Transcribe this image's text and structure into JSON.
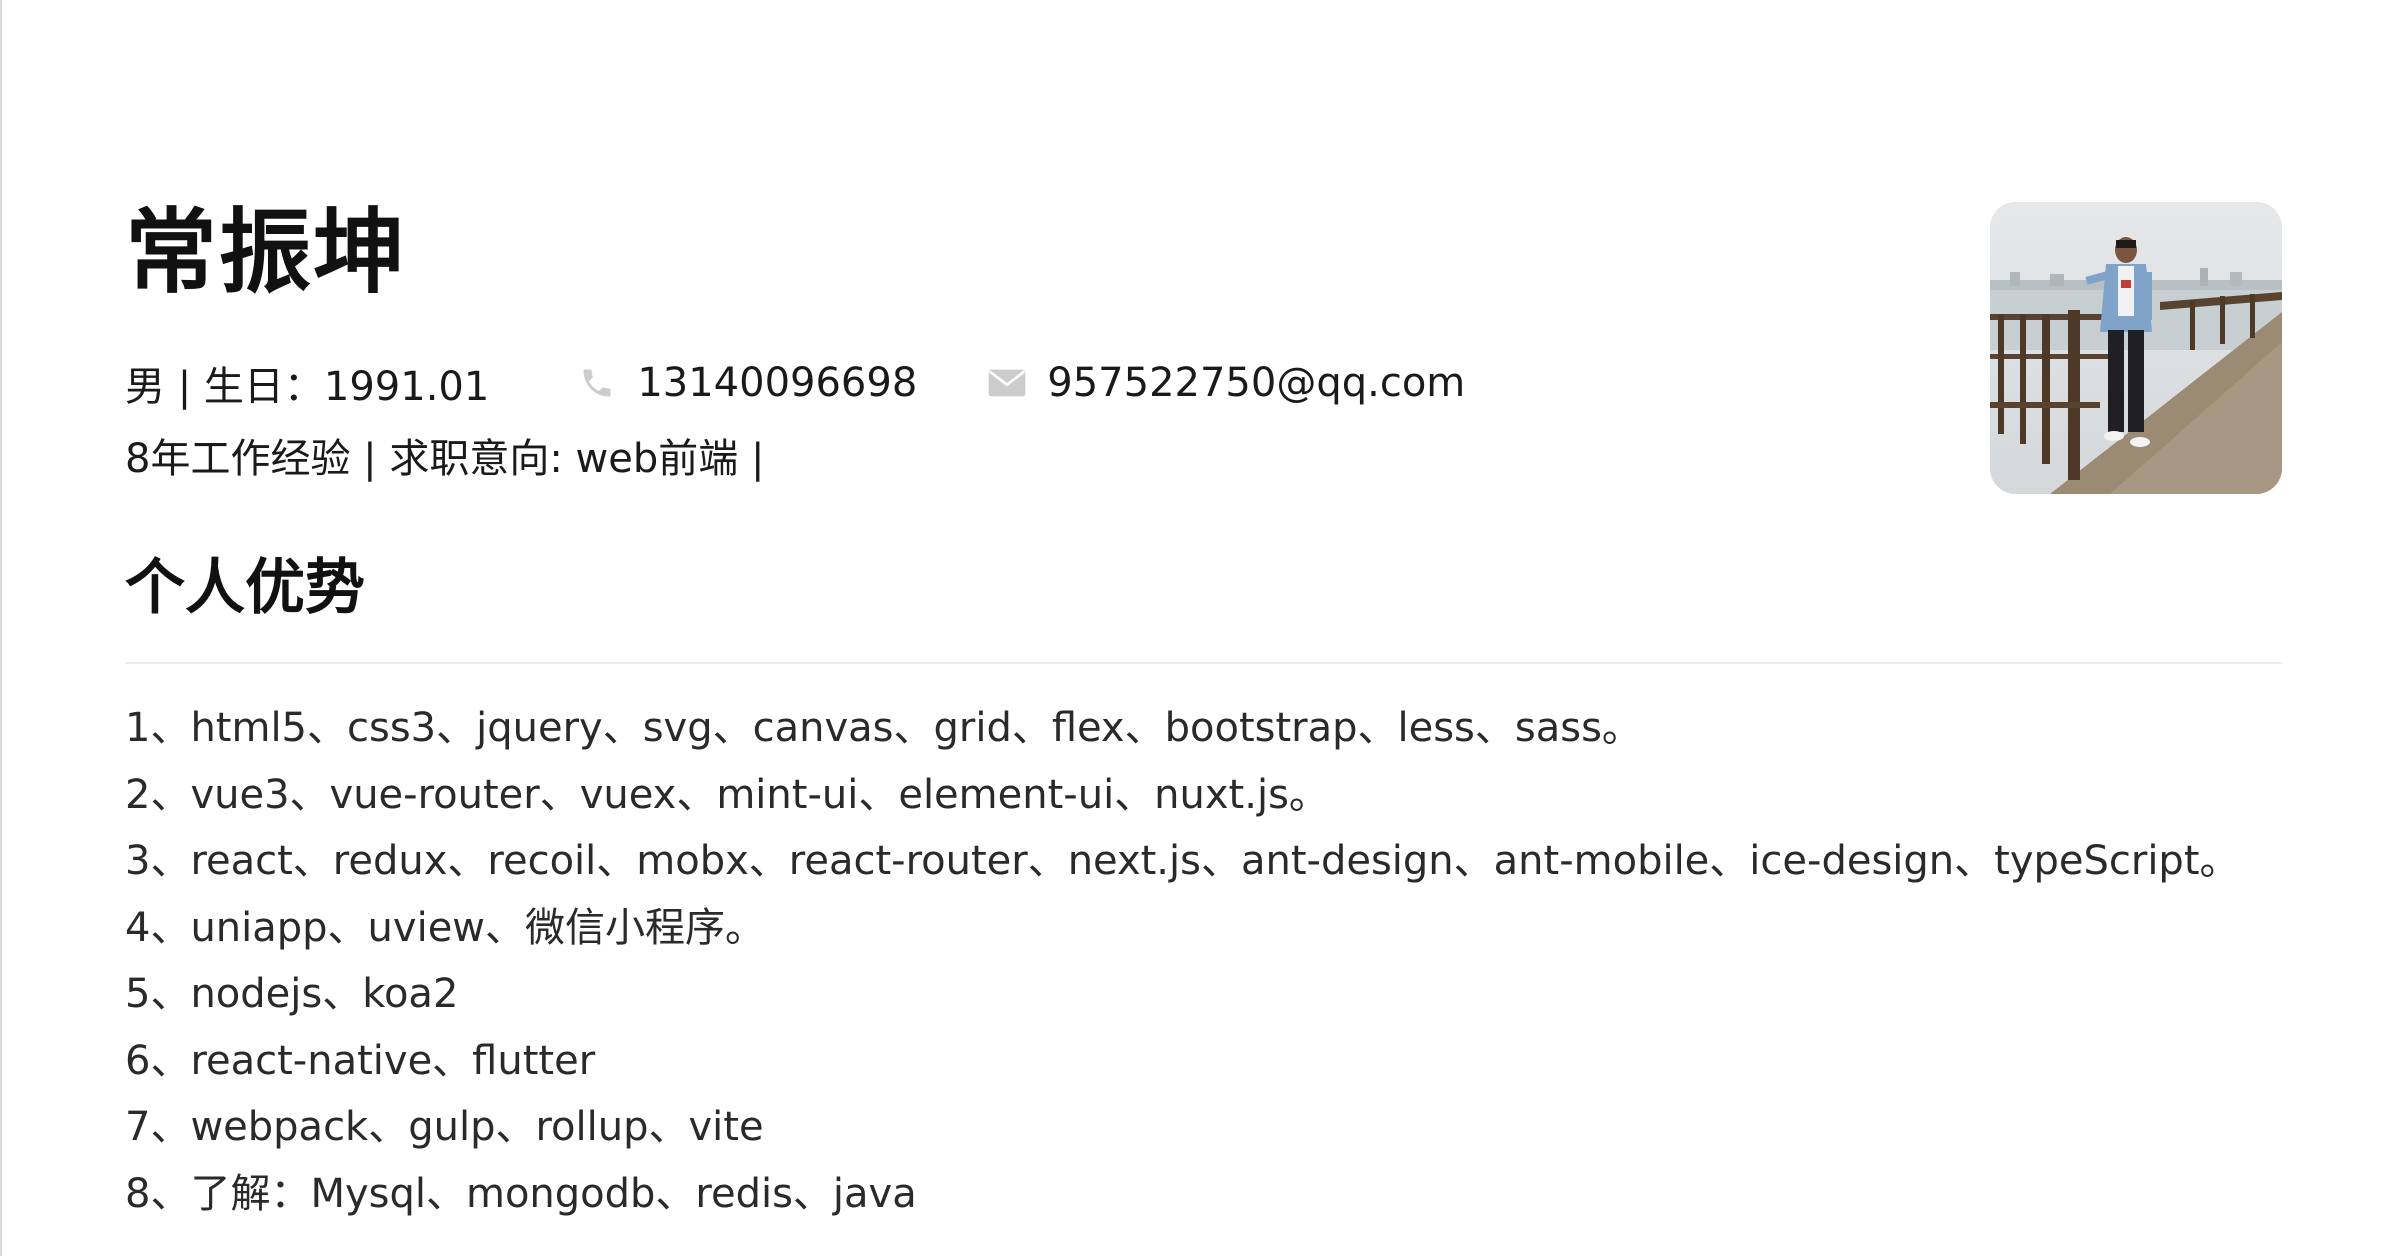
{
  "profile": {
    "name": "常振坤",
    "gender_birthday": "男 | 生日：1991.01",
    "phone": "13140096698",
    "email": "957522750@qq.com",
    "experience_intent": "8年工作经验 | 求职意向: web前端 |",
    "phone_icon": "phone-icon",
    "email_icon": "mail-icon"
  },
  "section": {
    "title": "个人优势",
    "items": [
      "1、html5、css3、jquery、svg、canvas、grid、flex、bootstrap、less、sass。",
      "2、vue3、vue-router、vuex、mint-ui、element-ui、nuxt.js。",
      "3、react、redux、recoil、mobx、react-router、next.js、ant-design、ant-mobile、ice-design、typeScript。",
      "4、uniapp、uview、微信小程序。",
      "5、nodejs、koa2",
      "6、react-native、flutter",
      "7、webpack、gulp、rollup、vite",
      "8、了解：Mysql、mongodb、redis、java"
    ]
  },
  "colors": {
    "text": "#1a1a1a",
    "icon": "#cccccc",
    "divider": "#ededed"
  }
}
